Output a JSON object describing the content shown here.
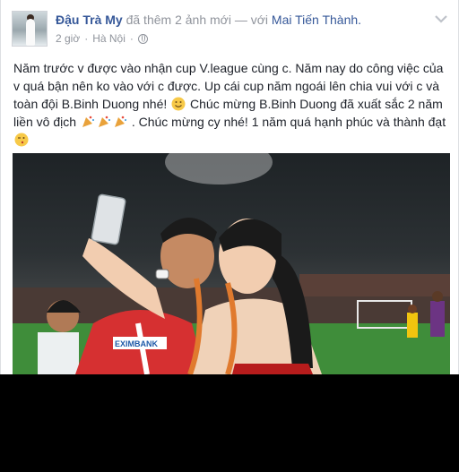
{
  "post": {
    "author": "Đậu Trà My",
    "action": "đã thêm 2 ảnh mới",
    "separator": "— với",
    "tagged": "Mai Tiến Thành.",
    "time": "2 giờ",
    "dot": "·",
    "location": "Hà Nội",
    "privacy_icon": "globe-icon",
    "menu_icon": "chevron-down-icon",
    "text_part1": "Năm trước v được vào nhận cup V.league cùng c. Năm nay do công việc của v quá bận nên ko vào với c được. Up cái cup năm ngoái lên chia vui với c và toàn đội B.Binh Duong nhé!",
    "text_part2": " Chúc mừng B.Binh Duong đã xuất sắc 2 năm liền vô địch",
    "text_part3": ". Chúc mừng cy nhé! 1 năm quá hạnh phúc và thành đạt",
    "photo_banner_text": "EXIMBANK"
  },
  "colors": {
    "link": "#365899",
    "meta": "#90949c",
    "text": "#1d2129",
    "background": "#000000"
  }
}
